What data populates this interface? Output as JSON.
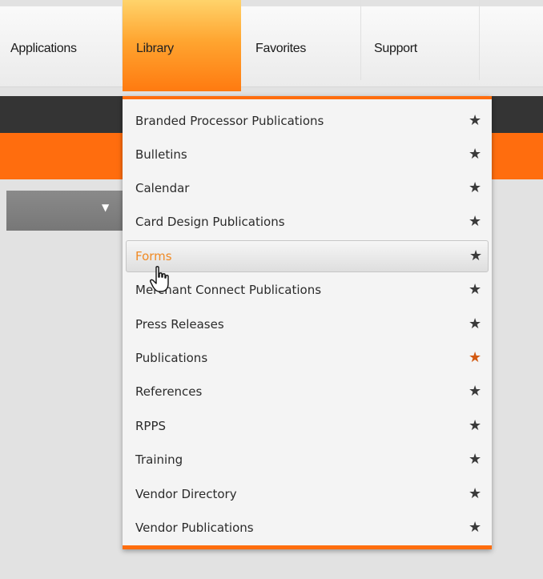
{
  "nav": {
    "items": [
      {
        "label": "Applications"
      },
      {
        "label": "Library"
      },
      {
        "label": "Favorites"
      },
      {
        "label": "Support"
      }
    ],
    "active": "Library"
  },
  "dropdown": {
    "items": [
      {
        "label": "Branded Processor Publications",
        "favorite": false
      },
      {
        "label": "Bulletins",
        "favorite": false
      },
      {
        "label": "Calendar",
        "favorite": false
      },
      {
        "label": "Card Design Publications",
        "favorite": false
      },
      {
        "label": "Forms",
        "favorite": false,
        "hovered": true
      },
      {
        "label": "Merchant Connect Publications",
        "favorite": false
      },
      {
        "label": "Press Releases",
        "favorite": false
      },
      {
        "label": "Publications",
        "favorite": true
      },
      {
        "label": "References",
        "favorite": false
      },
      {
        "label": "RPPS",
        "favorite": false
      },
      {
        "label": "Training",
        "favorite": false
      },
      {
        "label": "Vendor Directory",
        "favorite": false
      },
      {
        "label": "Vendor Publications",
        "favorite": false
      }
    ],
    "star_glyph": "★"
  },
  "colors": {
    "accent_orange": "#ff6d0e",
    "dark_bar": "#343434",
    "favorite_star": "#d35a12",
    "hover_text": "#f08a24"
  },
  "icons": {
    "favorite": "star-icon",
    "select_caret": "caret-down-icon",
    "pointer": "hand-cursor-icon"
  }
}
